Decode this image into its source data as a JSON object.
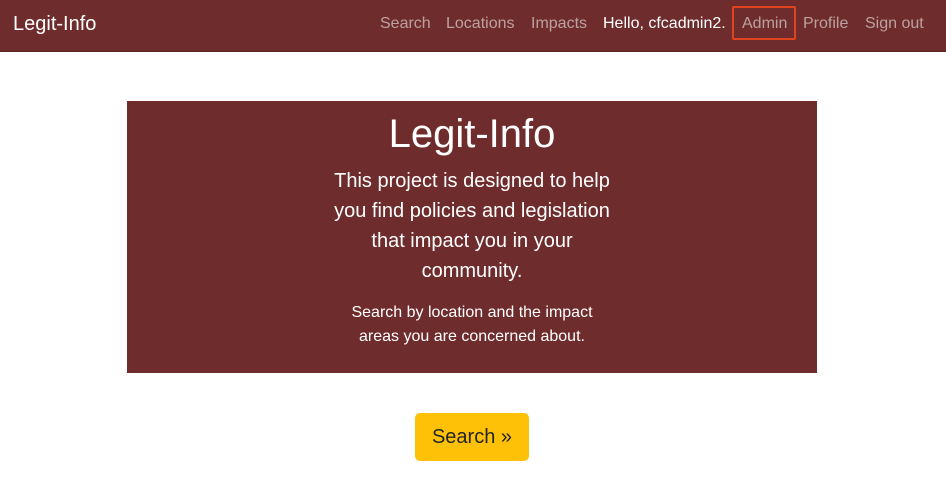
{
  "navbar": {
    "brand": "Legit-Info",
    "links": {
      "search": "Search",
      "locations": "Locations",
      "impacts": "Impacts"
    },
    "greeting": "Hello, cfcadmin2.",
    "admin": "Admin",
    "profile": "Profile",
    "signout": "Sign out"
  },
  "hero": {
    "title": "Legit-Info",
    "lead": "This project is designed to help you find policies and legislation that impact you in your community.",
    "sub": "Search by location and the impact areas you are concerned about."
  },
  "actions": {
    "search_button": "Search »"
  },
  "colors": {
    "brand": "#6e2c2c",
    "button": "#ffc107",
    "highlight": "#e0441f"
  }
}
